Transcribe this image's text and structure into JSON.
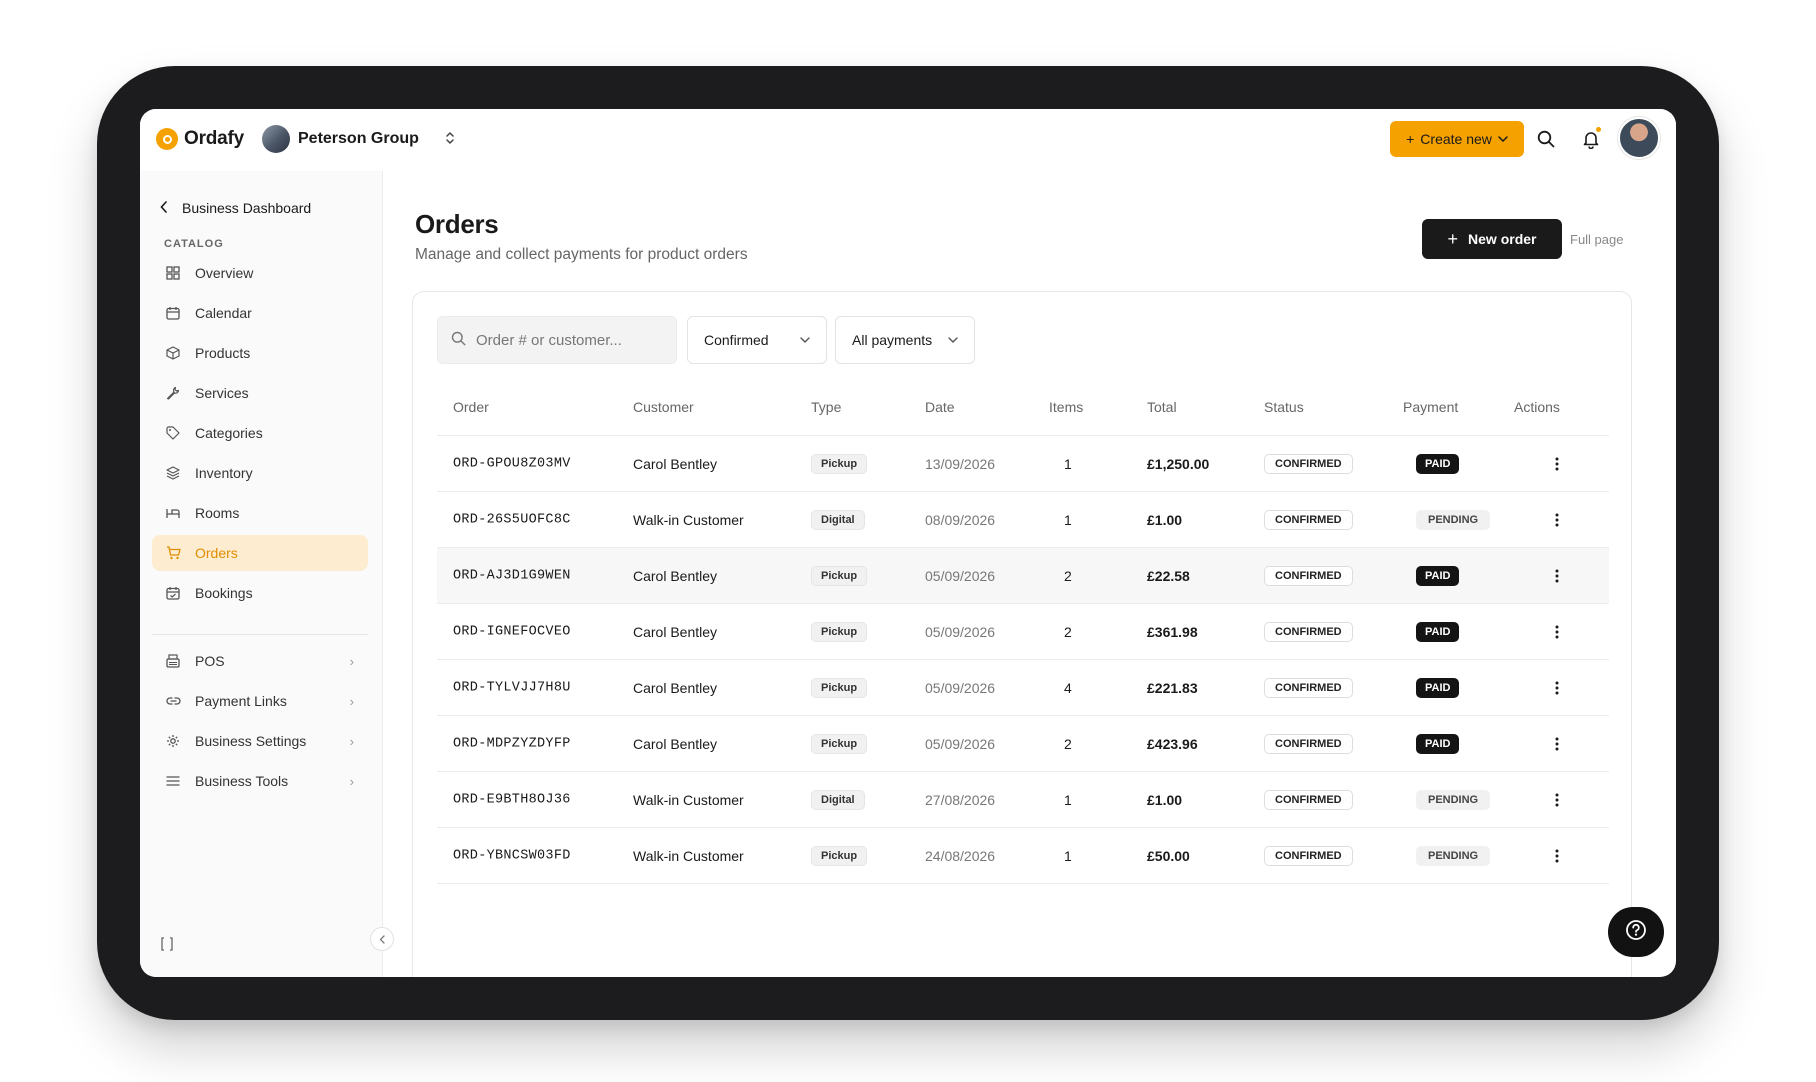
{
  "brand": {
    "name": "Ordafy",
    "accent": "#f5a100"
  },
  "org": {
    "name": "Peterson Group"
  },
  "topbar": {
    "create_label": "Create new"
  },
  "sidebar": {
    "back_label": "Business Dashboard",
    "section_label": "CATALOG",
    "items": [
      {
        "label": "Overview",
        "icon": "grid-icon"
      },
      {
        "label": "Calendar",
        "icon": "calendar-icon"
      },
      {
        "label": "Products",
        "icon": "box-icon"
      },
      {
        "label": "Services",
        "icon": "wrench-icon"
      },
      {
        "label": "Categories",
        "icon": "tag-icon"
      },
      {
        "label": "Inventory",
        "icon": "layers-icon"
      },
      {
        "label": "Rooms",
        "icon": "bed-icon"
      },
      {
        "label": "Orders",
        "icon": "cart-icon",
        "active": true
      },
      {
        "label": "Bookings",
        "icon": "calendar-check-icon"
      }
    ],
    "secondary": [
      {
        "label": "POS",
        "icon": "register-icon"
      },
      {
        "label": "Payment Links",
        "icon": "link-icon"
      },
      {
        "label": "Business Settings",
        "icon": "gear-icon"
      },
      {
        "label": "Business Tools",
        "icon": "menu-icon"
      }
    ]
  },
  "main": {
    "title": "Orders",
    "subtitle": "Manage and collect payments for product orders",
    "new_order_label": "New order",
    "full_page_label": "Full page",
    "search_placeholder": "Order # or customer...",
    "status_filter": "Confirmed",
    "payment_filter": "All payments"
  },
  "table": {
    "columns": [
      "Order",
      "Customer",
      "Type",
      "Date",
      "Items",
      "Total",
      "Status",
      "Payment",
      "Actions"
    ],
    "rows": [
      {
        "order": "ORD-GPOU8Z03MV",
        "customer": "Carol Bentley",
        "type": "Pickup",
        "date": "13/09/2026",
        "items": "1",
        "total": "£1,250.00",
        "status": "CONFIRMED",
        "payment": "PAID"
      },
      {
        "order": "ORD-26S5UOFC8C",
        "customer": "Walk-in Customer",
        "type": "Digital",
        "date": "08/09/2026",
        "items": "1",
        "total": "£1.00",
        "status": "CONFIRMED",
        "payment": "PENDING"
      },
      {
        "order": "ORD-AJ3D1G9WEN",
        "customer": "Carol Bentley",
        "type": "Pickup",
        "date": "05/09/2026",
        "items": "2",
        "total": "£22.58",
        "status": "CONFIRMED",
        "payment": "PAID"
      },
      {
        "order": "ORD-IGNEFOCVEO",
        "customer": "Carol Bentley",
        "type": "Pickup",
        "date": "05/09/2026",
        "items": "2",
        "total": "£361.98",
        "status": "CONFIRMED",
        "payment": "PAID"
      },
      {
        "order": "ORD-TYLVJJ7H8U",
        "customer": "Carol Bentley",
        "type": "Pickup",
        "date": "05/09/2026",
        "items": "4",
        "total": "£221.83",
        "status": "CONFIRMED",
        "payment": "PAID"
      },
      {
        "order": "ORD-MDPZYZDYFP",
        "customer": "Carol Bentley",
        "type": "Pickup",
        "date": "05/09/2026",
        "items": "2",
        "total": "£423.96",
        "status": "CONFIRMED",
        "payment": "PAID"
      },
      {
        "order": "ORD-E9BTH8OJ36",
        "customer": "Walk-in Customer",
        "type": "Digital",
        "date": "27/08/2026",
        "items": "1",
        "total": "£1.00",
        "status": "CONFIRMED",
        "payment": "PENDING"
      },
      {
        "order": "ORD-YBNCSW03FD",
        "customer": "Walk-in Customer",
        "type": "Pickup",
        "date": "24/08/2026",
        "items": "1",
        "total": "£50.00",
        "status": "CONFIRMED",
        "payment": "PENDING"
      }
    ]
  }
}
